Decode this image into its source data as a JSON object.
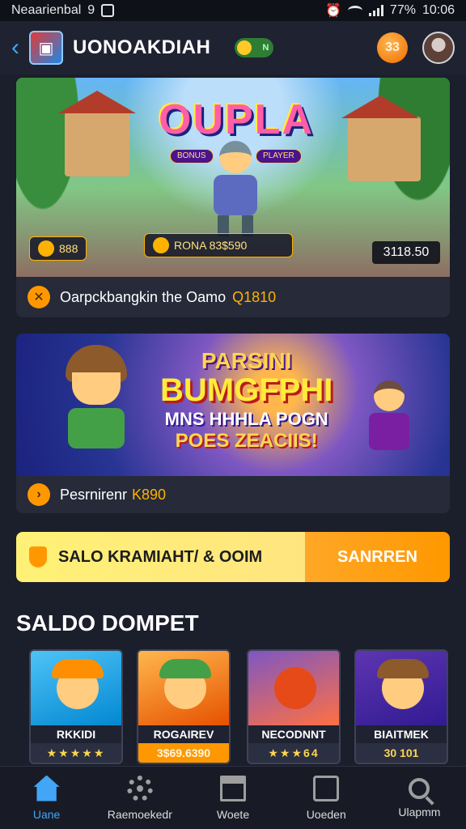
{
  "status_bar": {
    "carrier": "Neaarienbal",
    "network": "9",
    "battery": "77%",
    "time": "10:06"
  },
  "header": {
    "title": "UONOAKDIAH",
    "toggle_label": "N",
    "coin_value": "33"
  },
  "featured": {
    "game_logo": "OUPLA",
    "badge_left": "BONUS",
    "badge_right": "PLAYER",
    "chip_left": "888",
    "chip_center": "RONA 83$590",
    "score": "3118.50",
    "footer_text": "Oarpckbangkin the Oamo",
    "footer_value": "Q1810"
  },
  "promo": {
    "line1": "PARSINI",
    "line2": "BUMGFPHI",
    "line3": "MNS HHHLA POGN",
    "line4": "POES ZEACIIS!",
    "footer_text": "Pesrnirenr",
    "footer_value": "K890"
  },
  "saldo_bar": {
    "label": "SALO KRAMIAHT/ & OOIM",
    "button": "SANRREN"
  },
  "section": {
    "title": "SALDO DOMPET"
  },
  "tiles": [
    {
      "name": "RKKIDI",
      "sub": "★★★★★"
    },
    {
      "name": "ROGAIREV",
      "sub": "3$69.6390"
    },
    {
      "name": "NECODNNT",
      "sub": "★★★64"
    },
    {
      "name": "BIAITMEK",
      "sub": "30 101"
    }
  ],
  "nav": [
    {
      "label": "Uane"
    },
    {
      "label": "Raemoekedr"
    },
    {
      "label": "Woete"
    },
    {
      "label": "Uoeden"
    },
    {
      "label": "Ulapmm"
    }
  ],
  "colors": {
    "accent_orange": "#ff9800",
    "accent_blue": "#42a5f5",
    "saldo_yellow": "#fff176",
    "background": "#1b1e2b"
  }
}
